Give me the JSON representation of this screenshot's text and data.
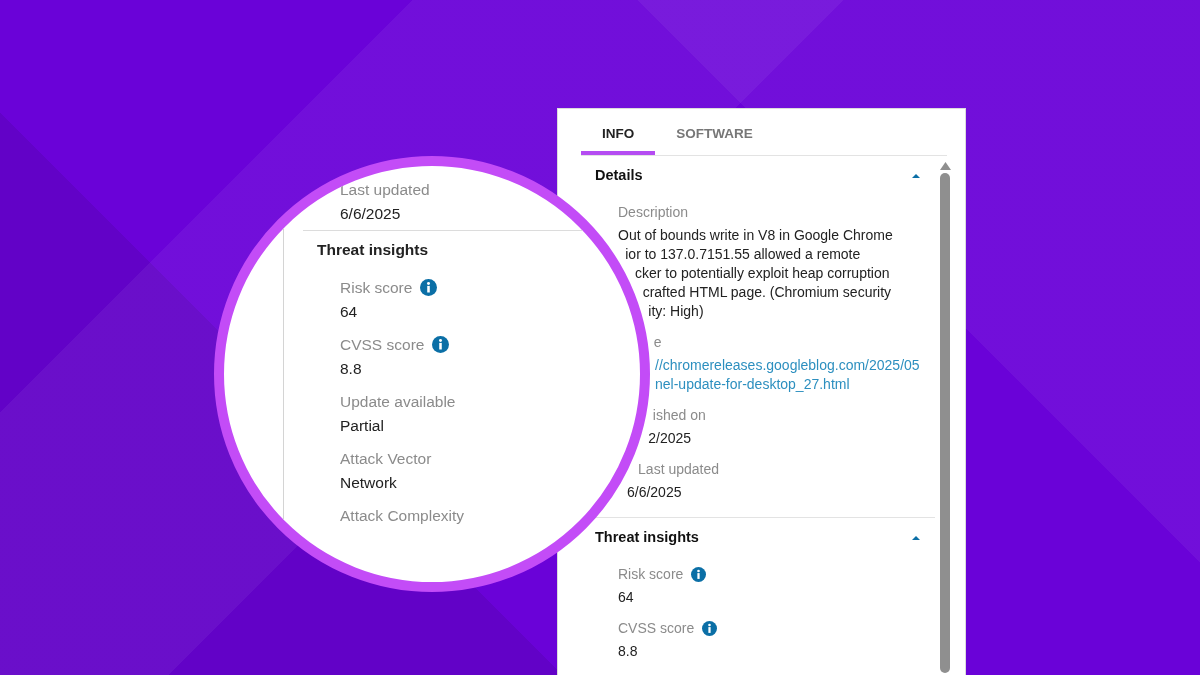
{
  "lens": {
    "fields": [
      {
        "label": "Last updated",
        "value": "6/6/2025",
        "info": false
      }
    ],
    "section": {
      "title": "Threat insights",
      "fields": [
        {
          "label": "Risk score",
          "value": "64",
          "info": true
        },
        {
          "label": "CVSS score",
          "value": "8.8",
          "info": true
        },
        {
          "label": "Update available",
          "value": "Partial",
          "info": false
        },
        {
          "label": "Attack Vector",
          "value": "Network",
          "info": false
        },
        {
          "label": "Attack Complexity",
          "info": false
        }
      ]
    }
  },
  "panel": {
    "tabs": [
      {
        "label": "INFO",
        "selected": true
      },
      {
        "label": "SOFTWARE",
        "selected": false
      }
    ],
    "sections": [
      {
        "title": "Details",
        "expanded": true,
        "fields": [
          {
            "kind": "text",
            "label": "Description",
            "info": false,
            "lines": [
              "Out of bounds write in V8 in Google Chrome",
              "ior to 137.0.7151.55 allowed a remote",
              "cker to potentially exploit heap corruption",
              "crafted HTML page. (Chromium security",
              "ity: High)"
            ]
          },
          {
            "kind": "link",
            "label": "e",
            "info": false,
            "lines": [
              "//chromereleases.googleblog.com/2025/05",
              "nel-update-for-desktop_27.html"
            ]
          },
          {
            "kind": "text",
            "label": "ished on",
            "info": false,
            "lines": [
              "2/2025"
            ]
          },
          {
            "kind": "text",
            "label": "Last updated",
            "info": false,
            "lines": [
              "6/6/2025"
            ]
          }
        ]
      },
      {
        "title": "Threat insights",
        "expanded": true,
        "fields": [
          {
            "kind": "text",
            "label": "Risk score",
            "info": true,
            "lines": [
              "64"
            ]
          },
          {
            "kind": "text",
            "label": "CVSS score",
            "info": true,
            "lines": [
              "8.8"
            ]
          }
        ]
      }
    ]
  }
}
